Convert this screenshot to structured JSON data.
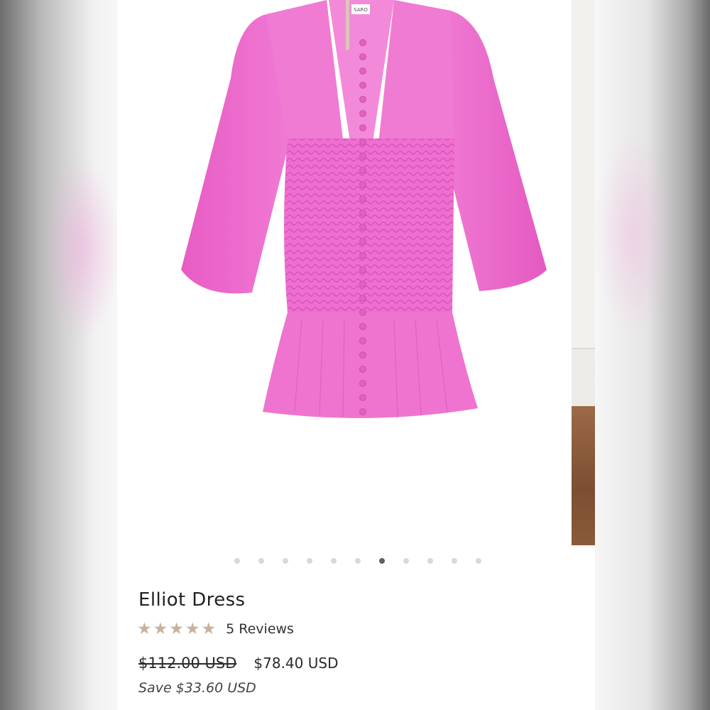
{
  "product": {
    "title": "Elliot Dress",
    "rating": 5,
    "rating_max": 5,
    "reviews_label": "5 Reviews",
    "original_price": "$112.00 USD",
    "sale_price": "$78.40 USD",
    "savings": "Save $33.60 USD",
    "image_label": "SARO"
  },
  "carousel": {
    "total_slides": 11,
    "active_index": 7
  },
  "colors": {
    "dress": "#ee6fd0",
    "star": "#c9b19a",
    "dot_active": "#606060",
    "dot_inactive": "#d9d9d9"
  },
  "icons": [
    "star-icon"
  ]
}
